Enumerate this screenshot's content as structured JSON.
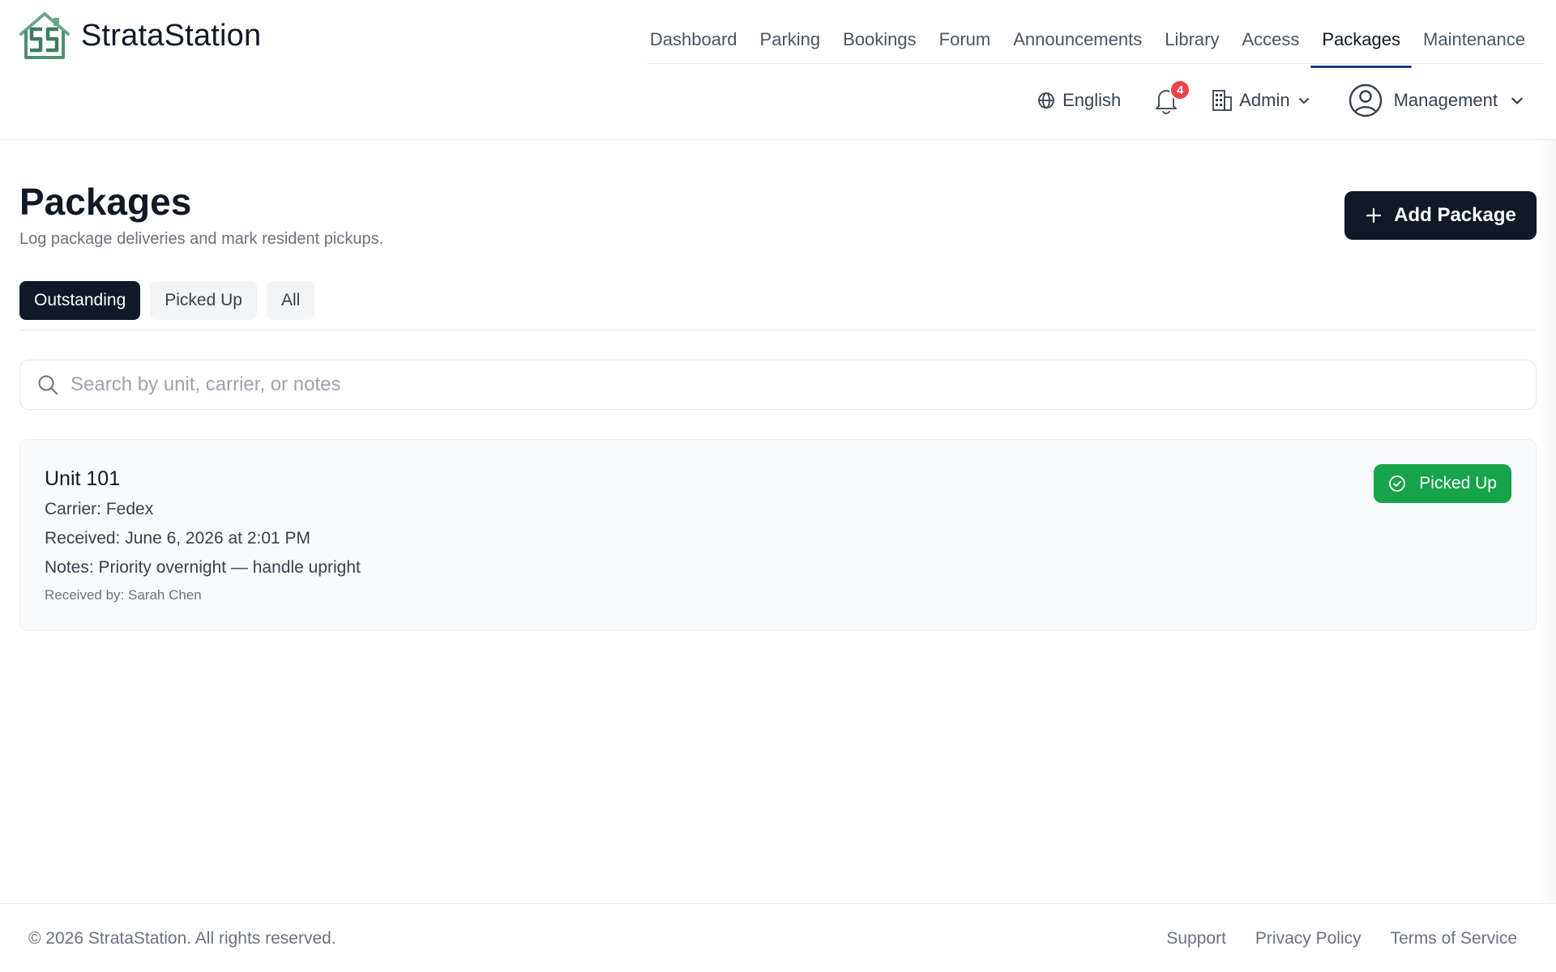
{
  "brand": {
    "name": "StrataStation"
  },
  "nav": {
    "items": [
      {
        "label": "Dashboard"
      },
      {
        "label": "Parking"
      },
      {
        "label": "Bookings"
      },
      {
        "label": "Forum"
      },
      {
        "label": "Announcements"
      },
      {
        "label": "Library"
      },
      {
        "label": "Access"
      },
      {
        "label": "Packages",
        "active": true
      },
      {
        "label": "Maintenance"
      }
    ]
  },
  "toolbar": {
    "language": "English",
    "notifications_count": "4",
    "building": "Admin",
    "user_role": "Management"
  },
  "page": {
    "title": "Packages",
    "subtitle": "Log package deliveries and mark resident pickups.",
    "add_button": "Add Package"
  },
  "tabs": [
    {
      "label": "Outstanding",
      "active": true
    },
    {
      "label": "Picked Up"
    },
    {
      "label": "All"
    }
  ],
  "search": {
    "placeholder": "Search by unit, carrier, or notes",
    "value": ""
  },
  "packages": [
    {
      "unit": "Unit 101",
      "carrier": "Carrier: Fedex",
      "received": "Received: June 6, 2026 at 2:01 PM",
      "notes": "Notes: Priority overnight — handle upright",
      "received_by": "Received by: Sarah Chen",
      "action": "Picked Up"
    }
  ],
  "footer": {
    "copyright": "© 2026 StrataStation. All rights reserved.",
    "links": [
      "Support",
      "Privacy Policy",
      "Terms of Service"
    ]
  },
  "colors": {
    "primary": "#111827",
    "accent_underline": "#1e3a8a",
    "success": "#16a34a",
    "badge": "#ef4444",
    "logo": "#5a9a7e"
  },
  "icons": {
    "logo": "building-logo-icon",
    "language": "globe-icon",
    "notifications": "bell-icon",
    "building": "building-icon",
    "user": "user-circle-icon",
    "dropdown": "chevron-down-icon",
    "add": "plus-icon",
    "search": "search-icon",
    "status": "check-circle-icon"
  }
}
